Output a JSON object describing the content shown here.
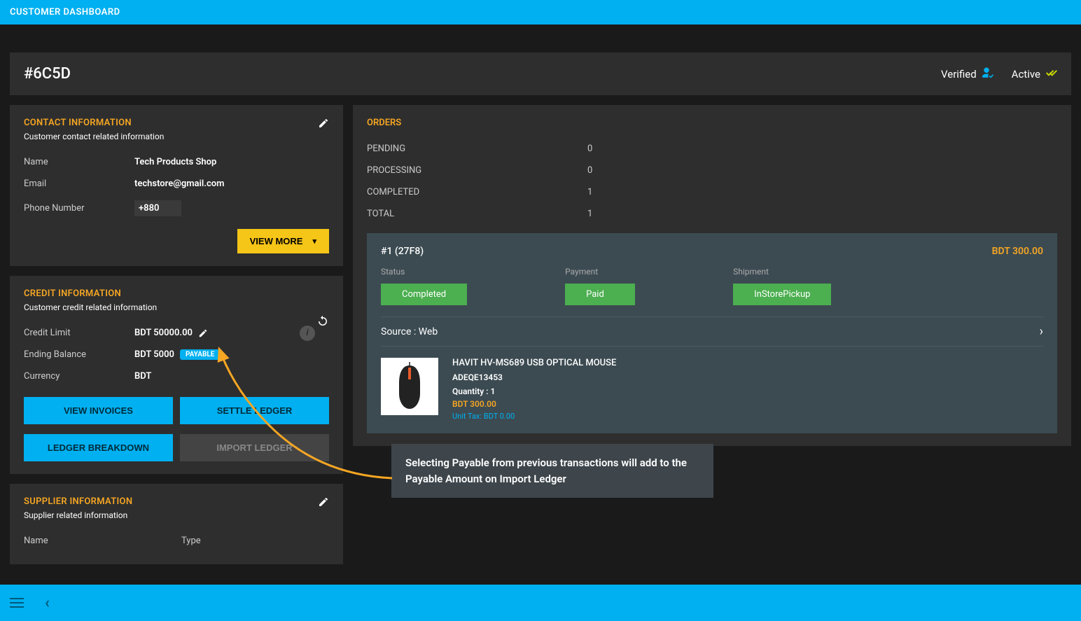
{
  "topbar": {
    "title": "CUSTOMER DASHBOARD"
  },
  "header": {
    "id": "#6C5D",
    "verified": "Verified",
    "active": "Active"
  },
  "contact": {
    "title": "CONTACT INFORMATION",
    "sub": "Customer contact related information",
    "name_label": "Name",
    "name_value": "Tech Products Shop",
    "email_label": "Email",
    "email_value": "techstore@gmail.com",
    "phone_label": "Phone Number",
    "phone_value": "+880",
    "view_more": "VIEW MORE"
  },
  "credit": {
    "title": "CREDIT INFORMATION",
    "sub": "Customer credit related information",
    "limit_label": "Credit Limit",
    "limit_value": "BDT 50000.00",
    "balance_label": "Ending Balance",
    "balance_value": "BDT 5000",
    "payable_badge": "PAYABLE",
    "currency_label": "Currency",
    "currency_value": "BDT",
    "btn_view_invoices": "VIEW INVOICES",
    "btn_settle": "SETTLE LEDGER",
    "btn_breakdown": "LEDGER BREAKDOWN",
    "btn_import": "IMPORT LEDGER"
  },
  "supplier": {
    "title": "SUPPLIER INFORMATION",
    "sub": "Supplier related information",
    "col1": "Name",
    "col2": "Type"
  },
  "orders": {
    "title": "ORDERS",
    "stats": {
      "pending_label": "PENDING",
      "pending_val": "0",
      "processing_label": "PROCESSING",
      "processing_val": "0",
      "completed_label": "COMPLETED",
      "completed_val": "1",
      "total_label": "TOTAL",
      "total_val": "1"
    },
    "order": {
      "id": "#1 (27F8)",
      "amount": "BDT 300.00",
      "status_label": "Status",
      "status_value": "Completed",
      "payment_label": "Payment",
      "payment_value": "Paid",
      "shipment_label": "Shipment",
      "shipment_value": "InStorePickup",
      "source_label": "Source : Web",
      "product_name": "HAVIT HV-MS689 USB OPTICAL MOUSE",
      "product_sku": "ADEQE13453",
      "product_qty": "Quantity : 1",
      "product_price": "BDT 300.00",
      "product_tax": "Unit Tax: BDT 0.00"
    }
  },
  "annotation": "Selecting Payable from previous transactions will add to the Payable Amount on Import Ledger",
  "info_icon": "i"
}
